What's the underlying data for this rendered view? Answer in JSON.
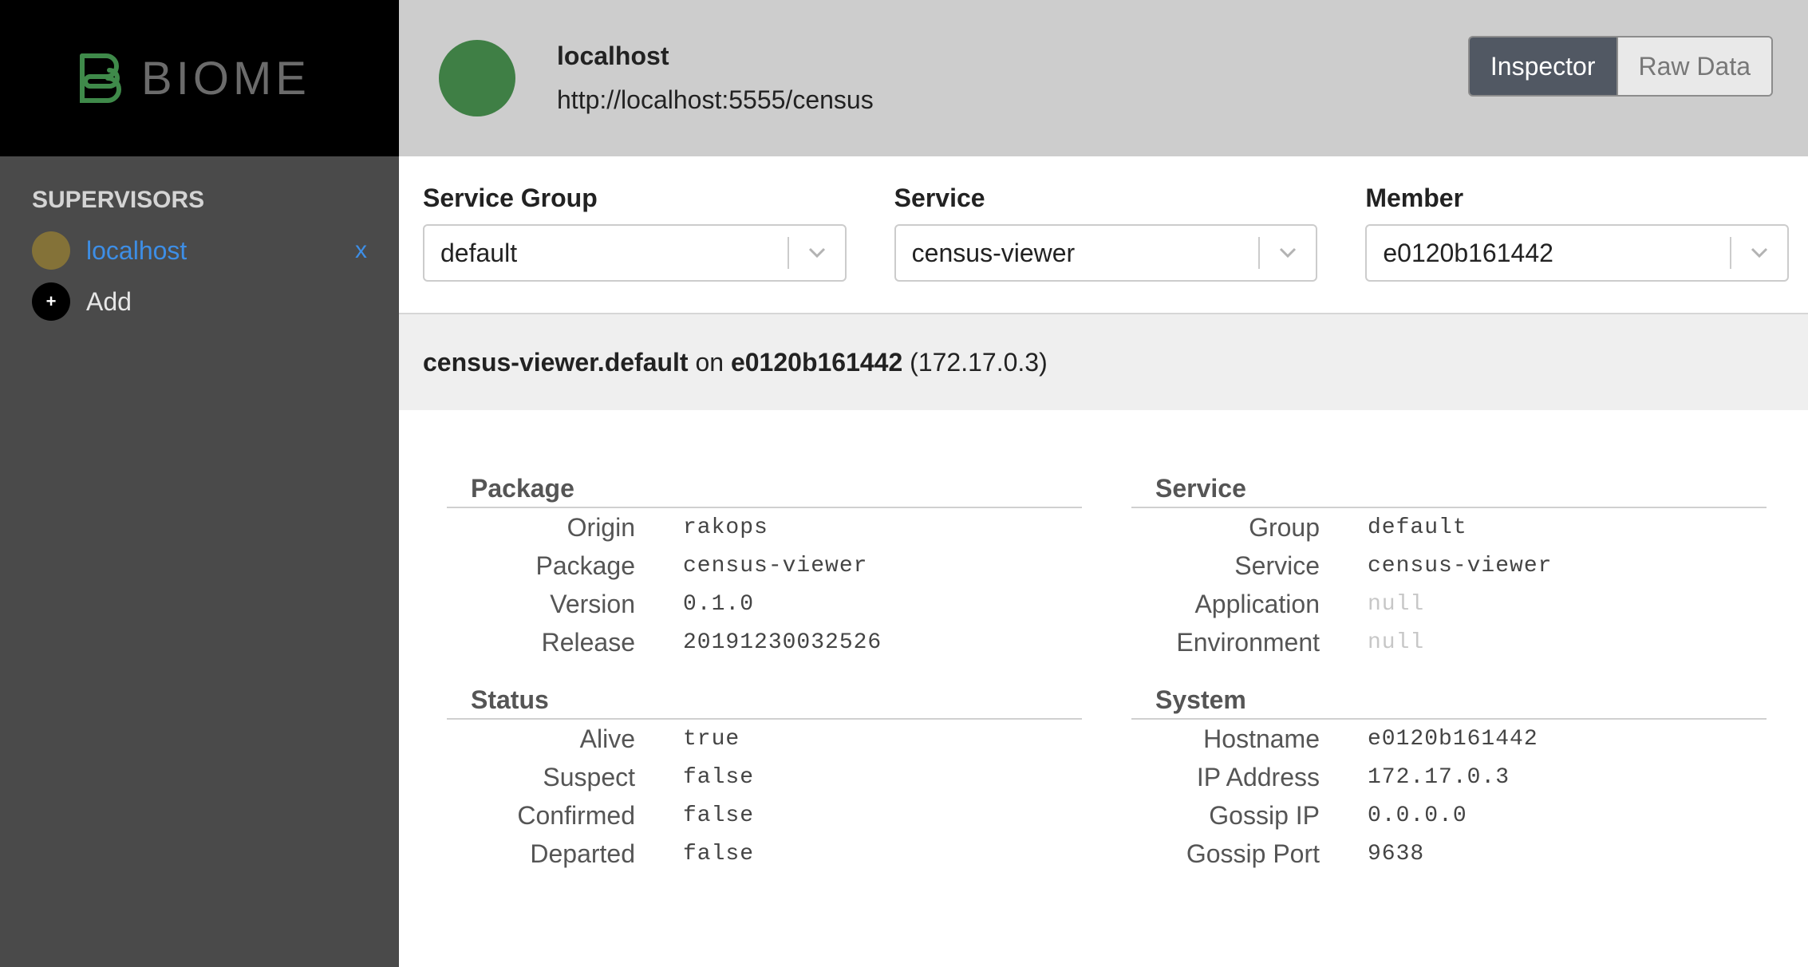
{
  "brand": {
    "name": "BIOME"
  },
  "sidebar": {
    "section_title": "SUPERVISORS",
    "items": [
      {
        "label": "localhost",
        "close": "x"
      }
    ],
    "add_label": "Add",
    "add_symbol": "+"
  },
  "header": {
    "name": "localhost",
    "url": "http://localhost:5555/census",
    "avatar_color": "#3f7f45",
    "views": {
      "active": "Inspector",
      "inactive": "Raw Data"
    }
  },
  "selectors": [
    {
      "label": "Service Group",
      "value": "default"
    },
    {
      "label": "Service",
      "value": "census-viewer"
    },
    {
      "label": "Member",
      "value": "e0120b161442"
    }
  ],
  "summary": {
    "service": "census-viewer.default",
    "on": "on",
    "member": "e0120b161442",
    "ip": "(172.17.0.3)"
  },
  "package": {
    "title": "Package",
    "rows": [
      {
        "key": "Origin",
        "value": "rakops"
      },
      {
        "key": "Package",
        "value": "census-viewer"
      },
      {
        "key": "Version",
        "value": "0.1.0"
      },
      {
        "key": "Release",
        "value": "20191230032526"
      }
    ]
  },
  "status": {
    "title": "Status",
    "rows": [
      {
        "key": "Alive",
        "value": "true"
      },
      {
        "key": "Suspect",
        "value": "false"
      },
      {
        "key": "Confirmed",
        "value": "false"
      },
      {
        "key": "Departed",
        "value": "false"
      }
    ]
  },
  "service": {
    "title": "Service",
    "rows": [
      {
        "key": "Group",
        "value": "default"
      },
      {
        "key": "Service",
        "value": "census-viewer"
      },
      {
        "key": "Application",
        "value": "null"
      },
      {
        "key": "Environment",
        "value": "null"
      }
    ]
  },
  "system": {
    "title": "System",
    "rows": [
      {
        "key": "Hostname",
        "value": "e0120b161442"
      },
      {
        "key": "IP Address",
        "value": "172.17.0.3"
      },
      {
        "key": "Gossip IP",
        "value": "0.0.0.0"
      },
      {
        "key": "Gossip Port",
        "value": "9638"
      }
    ]
  }
}
